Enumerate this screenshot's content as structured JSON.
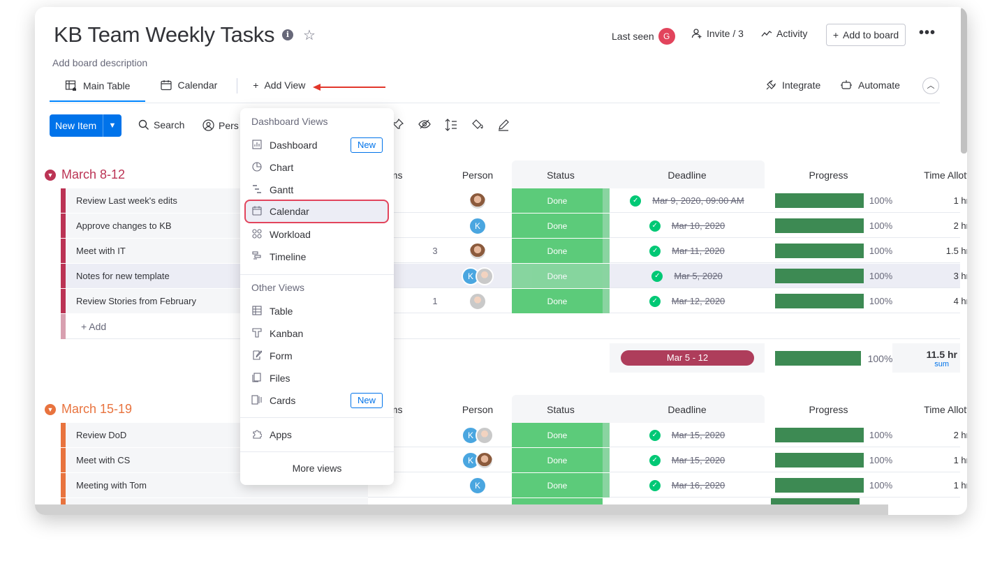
{
  "header": {
    "title": "KB Team Weekly Tasks",
    "description": "Add board description",
    "last_seen_label": "Last seen",
    "last_seen_avatar": "G",
    "invite_label": "Invite / 3",
    "activity_label": "Activity",
    "add_to_board_label": "Add to board",
    "more_label": "•••"
  },
  "tabs": {
    "main_table": "Main Table",
    "calendar": "Calendar",
    "add_view": "Add View",
    "integrate": "Integrate",
    "automate": "Automate"
  },
  "toolbar": {
    "new_item": "New Item",
    "search": "Search",
    "person": "Pers"
  },
  "columns": {
    "items": "ems",
    "person": "Person",
    "status": "Status",
    "deadline": "Deadline",
    "progress": "Progress",
    "time": "Time Allott"
  },
  "groups": [
    {
      "title": "March 8-12",
      "color": "#bb3354",
      "add_label": "+ Add",
      "rows": [
        {
          "name": "Review Last week's edits",
          "sub": "",
          "status": "Done",
          "deadline": "Mar 9, 2020, 09:00 AM",
          "progress": "100%",
          "time": "1 hr"
        },
        {
          "name": "Approve changes to KB",
          "sub": "",
          "status": "Done",
          "deadline": "Mar 10, 2020",
          "progress": "100%",
          "time": "2 hr"
        },
        {
          "name": "Meet with IT",
          "sub": "3",
          "status": "Done",
          "deadline": "Mar 11, 2020",
          "progress": "100%",
          "time": "1.5 hr"
        },
        {
          "name": "Notes for new template",
          "sub": "",
          "status": "Done",
          "deadline": "Mar 5, 2020",
          "progress": "100%",
          "time": "3 hr"
        },
        {
          "name": "Review Stories from February",
          "sub": "1",
          "status": "Done",
          "deadline": "Mar 12, 2020",
          "progress": "100%",
          "time": "4 hr"
        }
      ],
      "summary": {
        "range": "Mar 5 - 12",
        "progress": "100%",
        "time": "11.5 hr",
        "time_note": "sum"
      }
    },
    {
      "title": "March 15-19",
      "color": "#e8733e",
      "rows": [
        {
          "name": "Review DoD",
          "status": "Done",
          "deadline": "Mar 15, 2020",
          "progress": "100%",
          "time": "2 hr"
        },
        {
          "name": "Meet with CS",
          "status": "Done",
          "deadline": "Mar 15, 2020",
          "progress": "100%",
          "time": "1 hr"
        },
        {
          "name": "Meeting with Tom",
          "status": "Done",
          "deadline": "Mar 16, 2020",
          "progress": "100%",
          "time": "1 hr"
        }
      ]
    }
  ],
  "avatars": {
    "k": "K"
  },
  "dropdown": {
    "dashboard_views_label": "Dashboard Views",
    "other_views_label": "Other Views",
    "items": {
      "dashboard": "Dashboard",
      "chart": "Chart",
      "gantt": "Gantt",
      "calendar": "Calendar",
      "workload": "Workload",
      "timeline": "Timeline",
      "table": "Table",
      "kanban": "Kanban",
      "form": "Form",
      "files": "Files",
      "cards": "Cards",
      "apps": "Apps"
    },
    "new_badge": "New",
    "more_views": "More views"
  }
}
